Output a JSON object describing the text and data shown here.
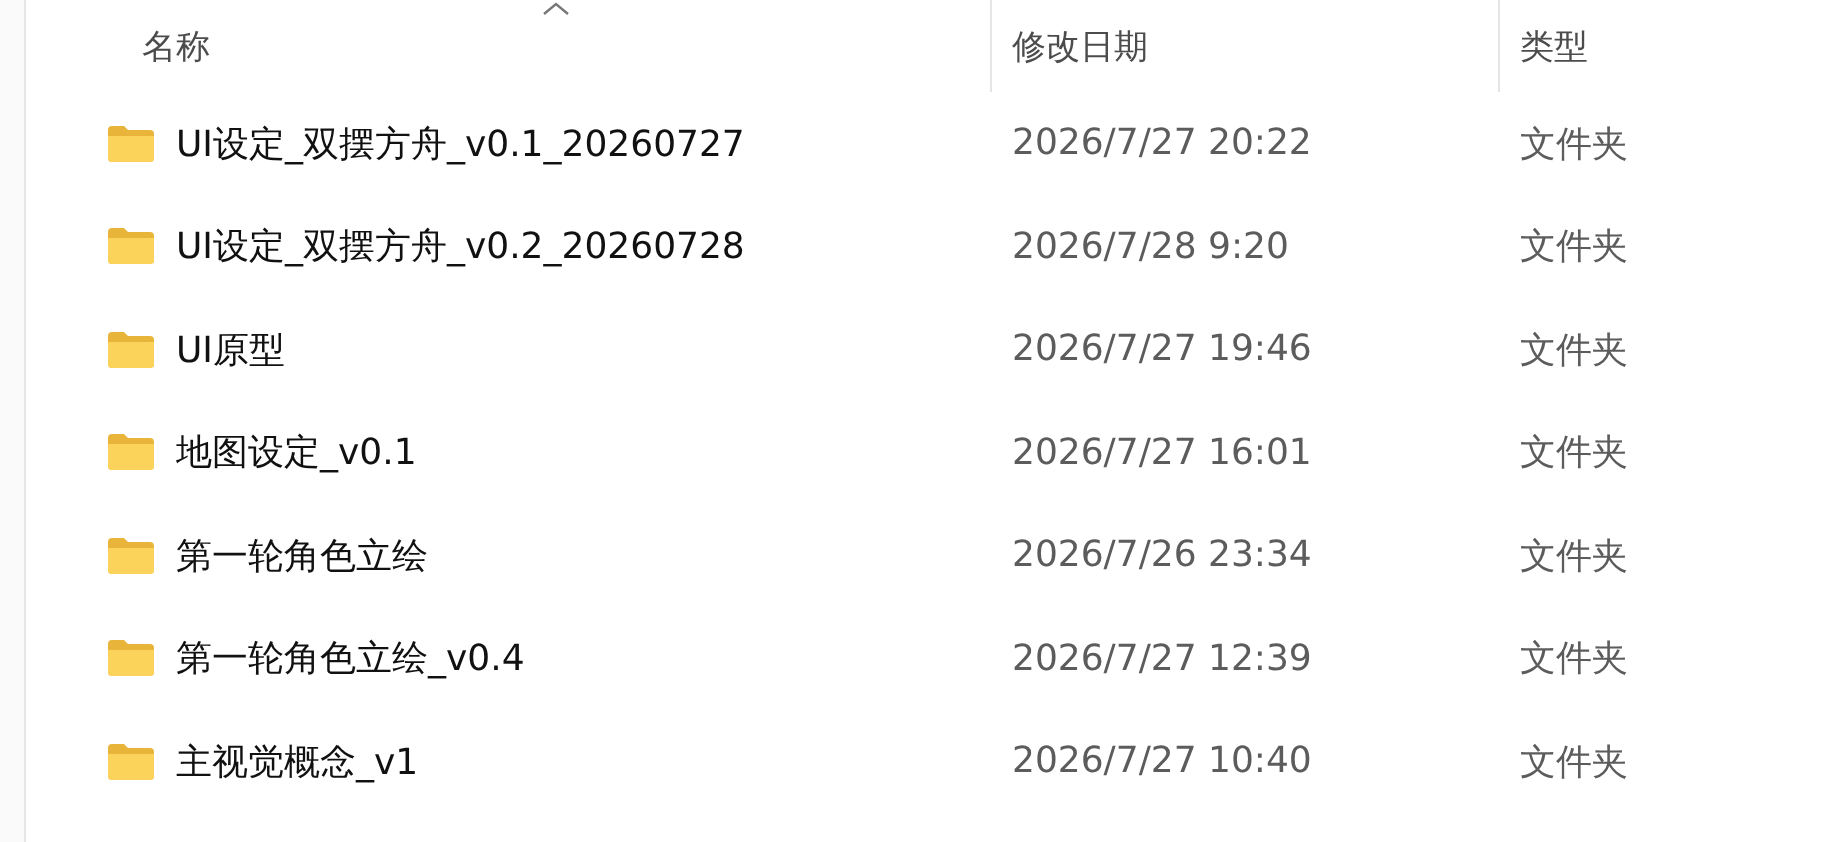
{
  "columns": [
    {
      "label": "名称",
      "sorted": true
    },
    {
      "label": "修改日期",
      "sorted": false
    },
    {
      "label": "类型",
      "sorted": false
    }
  ],
  "rows": [
    {
      "name": "UI设定_双摆方舟_v0.1_20260727",
      "modified": "2026/7/27 20:22",
      "type": "文件夹"
    },
    {
      "name": "UI设定_双摆方舟_v0.2_20260728",
      "modified": "2026/7/28 9:20",
      "type": "文件夹"
    },
    {
      "name": "UI原型",
      "modified": "2026/7/27 19:46",
      "type": "文件夹"
    },
    {
      "name": "地图设定_v0.1",
      "modified": "2026/7/27 16:01",
      "type": "文件夹"
    },
    {
      "name": "第一轮角色立绘",
      "modified": "2026/7/26 23:34",
      "type": "文件夹"
    },
    {
      "name": "第一轮角色立绘_v0.4",
      "modified": "2026/7/27 12:39",
      "type": "文件夹"
    },
    {
      "name": "主视觉概念_v1",
      "modified": "2026/7/27 10:40",
      "type": "文件夹"
    }
  ]
}
